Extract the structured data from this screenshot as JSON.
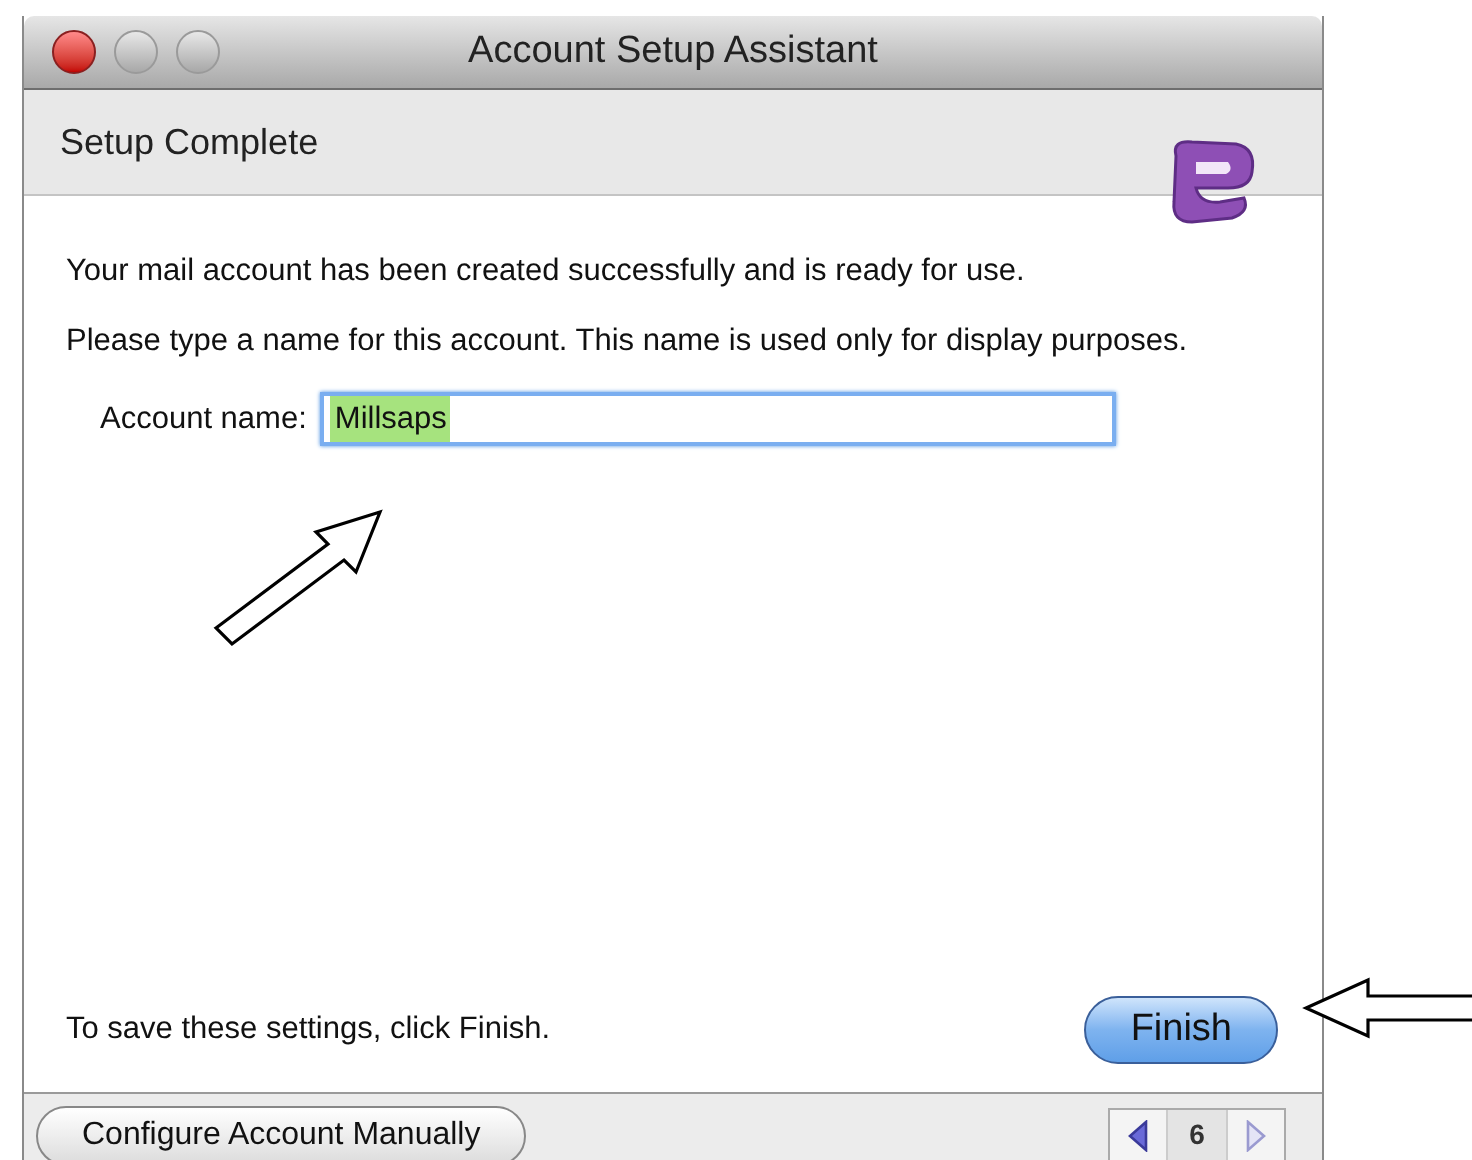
{
  "window": {
    "title": "Account Setup Assistant"
  },
  "header": {
    "title": "Setup Complete"
  },
  "body": {
    "message": "Your mail account has been created successfully and is ready for use.",
    "instruction": "Please type a name for this account. This name is used only for display purposes.",
    "field": {
      "label": "Account name:",
      "value": "Millsaps",
      "selected": true
    },
    "footer_text": "To save these settings, click Finish.",
    "primary_button": "Finish"
  },
  "bottom_bar": {
    "button": "Configure Account Manually",
    "page": "6",
    "previous_disabled": false,
    "next_disabled": true
  }
}
